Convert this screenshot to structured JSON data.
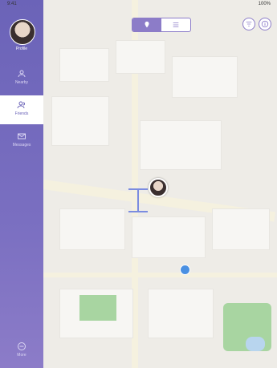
{
  "status": {
    "time": "9:41",
    "battery": "100%"
  },
  "sidebar": {
    "username": "Profile",
    "items": [
      {
        "label": "Nearby",
        "icon": "user-icon"
      },
      {
        "label": "Friends",
        "icon": "users-icon"
      },
      {
        "label": "Messages",
        "icon": "mail-icon"
      }
    ],
    "bottom_label": "More"
  },
  "map": {
    "toggle": [
      {
        "icon": "map-pin-icon"
      },
      {
        "icon": "list-icon"
      }
    ],
    "buttons": [
      {
        "icon": "filter-icon"
      },
      {
        "icon": "info-icon"
      }
    ]
  }
}
